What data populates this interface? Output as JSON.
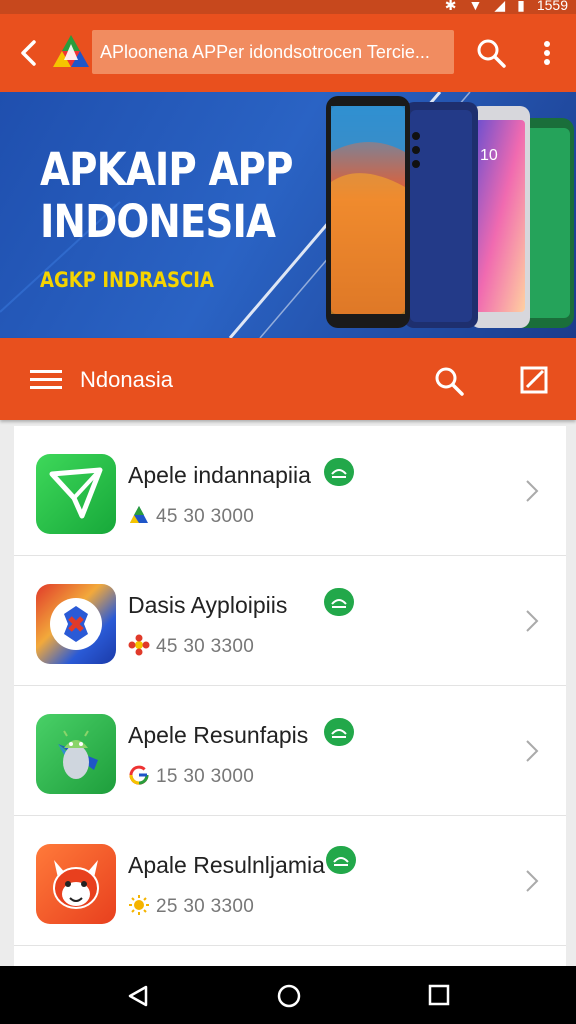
{
  "status_bar": {
    "time": "1559"
  },
  "app_bar": {
    "title": "APloonena APPer idondsotrocen Tercie..."
  },
  "banner": {
    "title_line1": "APKAIP APP",
    "title_line2": "INDONESIA",
    "subtitle": "AGKP INDRASCIA",
    "phone_screen_text": "10"
  },
  "toolbar": {
    "title": "Ndonasia"
  },
  "apps": [
    {
      "name": "Apele indannapiia",
      "meta": "45 30 3000",
      "icon": "paper-plane-app-icon",
      "meta_icon": "drive-icon"
    },
    {
      "name": "Dasis Ayploipiis",
      "meta": "45 30 3300",
      "icon": "swirl-app-icon",
      "meta_icon": "flower-icon"
    },
    {
      "name": "Apele Resunfapis",
      "meta": "15 30 3000",
      "icon": "android-robot-app-icon",
      "meta_icon": "google-icon"
    },
    {
      "name": "Apale Resulnljamia",
      "meta": "25 30 3300",
      "icon": "fox-app-icon",
      "meta_icon": "sun-icon"
    }
  ],
  "colors": {
    "primary": "#e9501e",
    "status": "#c7481d",
    "banner": "#2a63c4",
    "accent_yellow": "#f5d400",
    "badge_green": "#22a84a"
  }
}
